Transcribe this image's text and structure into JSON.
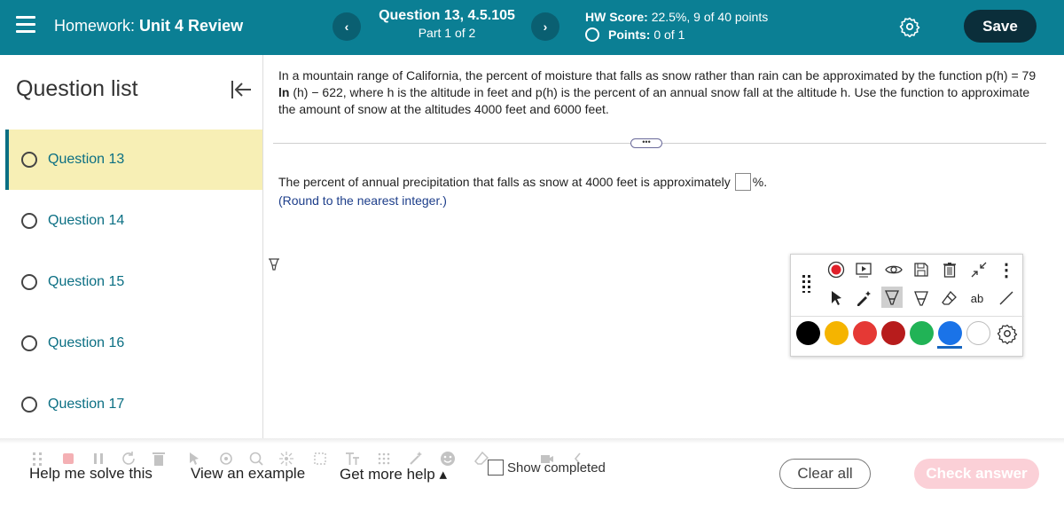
{
  "header": {
    "homework_prefix": "Homework:",
    "homework_name": "Unit 4 Review",
    "question_title": "Question 13, 4.5.105",
    "question_part": "Part 1 of 2",
    "hw_score_label": "HW Score:",
    "hw_score_value": "22.5%, 9 of 40 points",
    "points_label": "Points:",
    "points_value": "0 of 1",
    "prev_icon": "‹",
    "next_icon": "›",
    "save_label": "Save"
  },
  "sidebar": {
    "title": "Question list",
    "items": [
      {
        "label": "Question 13",
        "active": true
      },
      {
        "label": "Question 14"
      },
      {
        "label": "Question 15"
      },
      {
        "label": "Question 16"
      },
      {
        "label": "Question 17"
      }
    ]
  },
  "problem": {
    "text_part1": "In a mountain range of California, the percent of moisture that falls as snow rather than rain can be approximated by the function p(h) = 79 ",
    "text_bold": "ln",
    "text_part2": " (h) − 622, where h is the altitude in feet and p(h) is the percent of an annual snow fall at the altitude h. Use the function to approximate the amount of snow at the altitudes 4000 feet and 6000 feet.",
    "divider_handle": "•••",
    "answer_prefix": "The percent of annual precipitation that falls as snow at 4000 feet is approximately",
    "answer_suffix": "%.",
    "round_note": "(Round to the nearest integer.)"
  },
  "annotation_toolbar": {
    "more_icon": "⋮",
    "text_tool_label": "ab",
    "colors": [
      "#000000",
      "#f5b400",
      "#e53935",
      "#b71c1c",
      "#21b356",
      "#1a73e8",
      "#ffffff"
    ]
  },
  "bottom": {
    "help_solve": "Help me solve this",
    "view_example": "View an example",
    "get_more_help": "Get more help ▴",
    "show_completed": "Show completed",
    "clear_all": "Clear all",
    "check_answer": "Check answer"
  }
}
